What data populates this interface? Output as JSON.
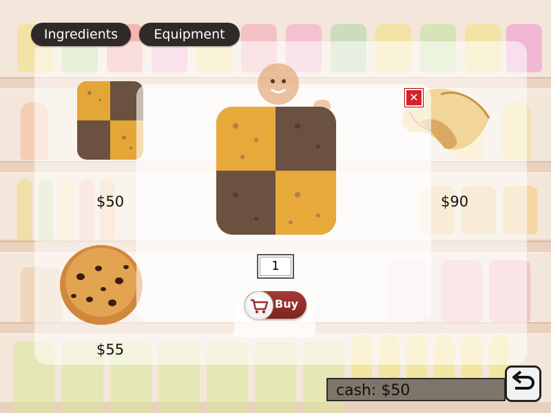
{
  "tabs": [
    {
      "label": "Ingredients"
    },
    {
      "label": "Equipment"
    }
  ],
  "shop_items": [
    {
      "icon": "checkerboard-cookie-icon",
      "price": "$50"
    },
    {
      "icon": "fortune-cookie-icon",
      "price": "$90"
    },
    {
      "icon": "chocolate-chip-cookie-icon",
      "price": "$55"
    }
  ],
  "detail": {
    "icon": "checkerboard-cookie-icon",
    "quantity": "1",
    "buy_label": "Buy",
    "buy_icon": "cart-icon",
    "close_icon": "close-icon"
  },
  "cash": {
    "label": "cash: $50"
  },
  "back_icon": "undo-arrow-icon",
  "colors": {
    "tab_bg": "#2f2a28",
    "buy_button": "#8c2b27",
    "close": "#d6202a",
    "cash_bg": "#7e7569"
  }
}
